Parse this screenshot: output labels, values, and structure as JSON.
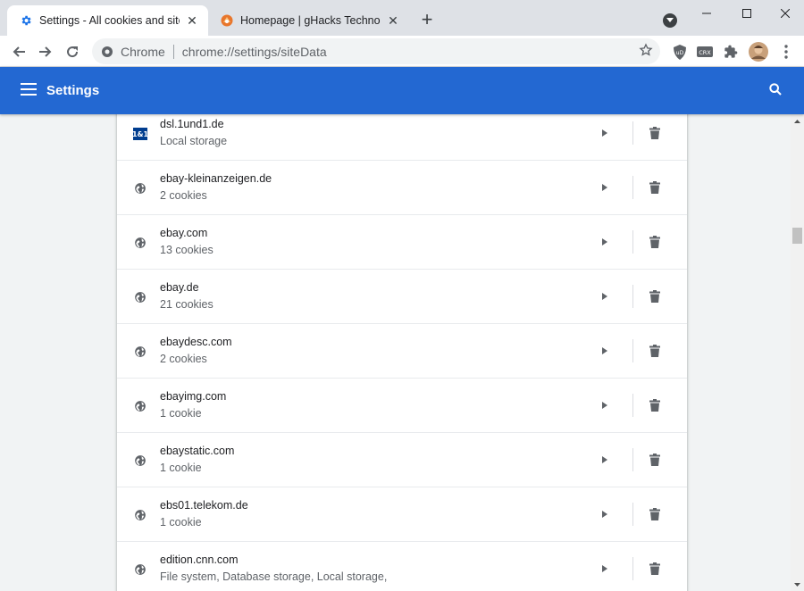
{
  "browser": {
    "tabs": [
      {
        "title": "Settings - All cookies and site data",
        "icon": "gear-icon",
        "active": true
      },
      {
        "title": "Homepage | gHacks Technology News",
        "icon": "ghacks-icon",
        "active": false
      }
    ],
    "new_tab_label": "+",
    "omnibox": {
      "chip": "Chrome",
      "url": "chrome://settings/siteData"
    },
    "extension_labels": {
      "ublock": "uD",
      "ext2": "CRX"
    }
  },
  "settings": {
    "title": "Settings"
  },
  "site_list": [
    {
      "name": "dsl.1und1.de",
      "detail": "Local storage",
      "icon": "brand-1und1-icon",
      "logo_text": "1&1"
    },
    {
      "name": "ebay-kleinanzeigen.de",
      "detail": "2 cookies",
      "icon": "globe-icon"
    },
    {
      "name": "ebay.com",
      "detail": "13 cookies",
      "icon": "globe-icon"
    },
    {
      "name": "ebay.de",
      "detail": "21 cookies",
      "icon": "globe-icon"
    },
    {
      "name": "ebaydesc.com",
      "detail": "2 cookies",
      "icon": "globe-icon"
    },
    {
      "name": "ebayimg.com",
      "detail": "1 cookie",
      "icon": "globe-icon"
    },
    {
      "name": "ebaystatic.com",
      "detail": "1 cookie",
      "icon": "globe-icon"
    },
    {
      "name": "ebs01.telekom.de",
      "detail": "1 cookie",
      "icon": "globe-icon"
    },
    {
      "name": "edition.cnn.com",
      "detail": "File system, Database storage, Local storage,",
      "icon": "globe-icon"
    }
  ],
  "scroll_position": 0.23,
  "colors": {
    "accent": "#2368d2",
    "tab_strip": "#dee1e6"
  }
}
